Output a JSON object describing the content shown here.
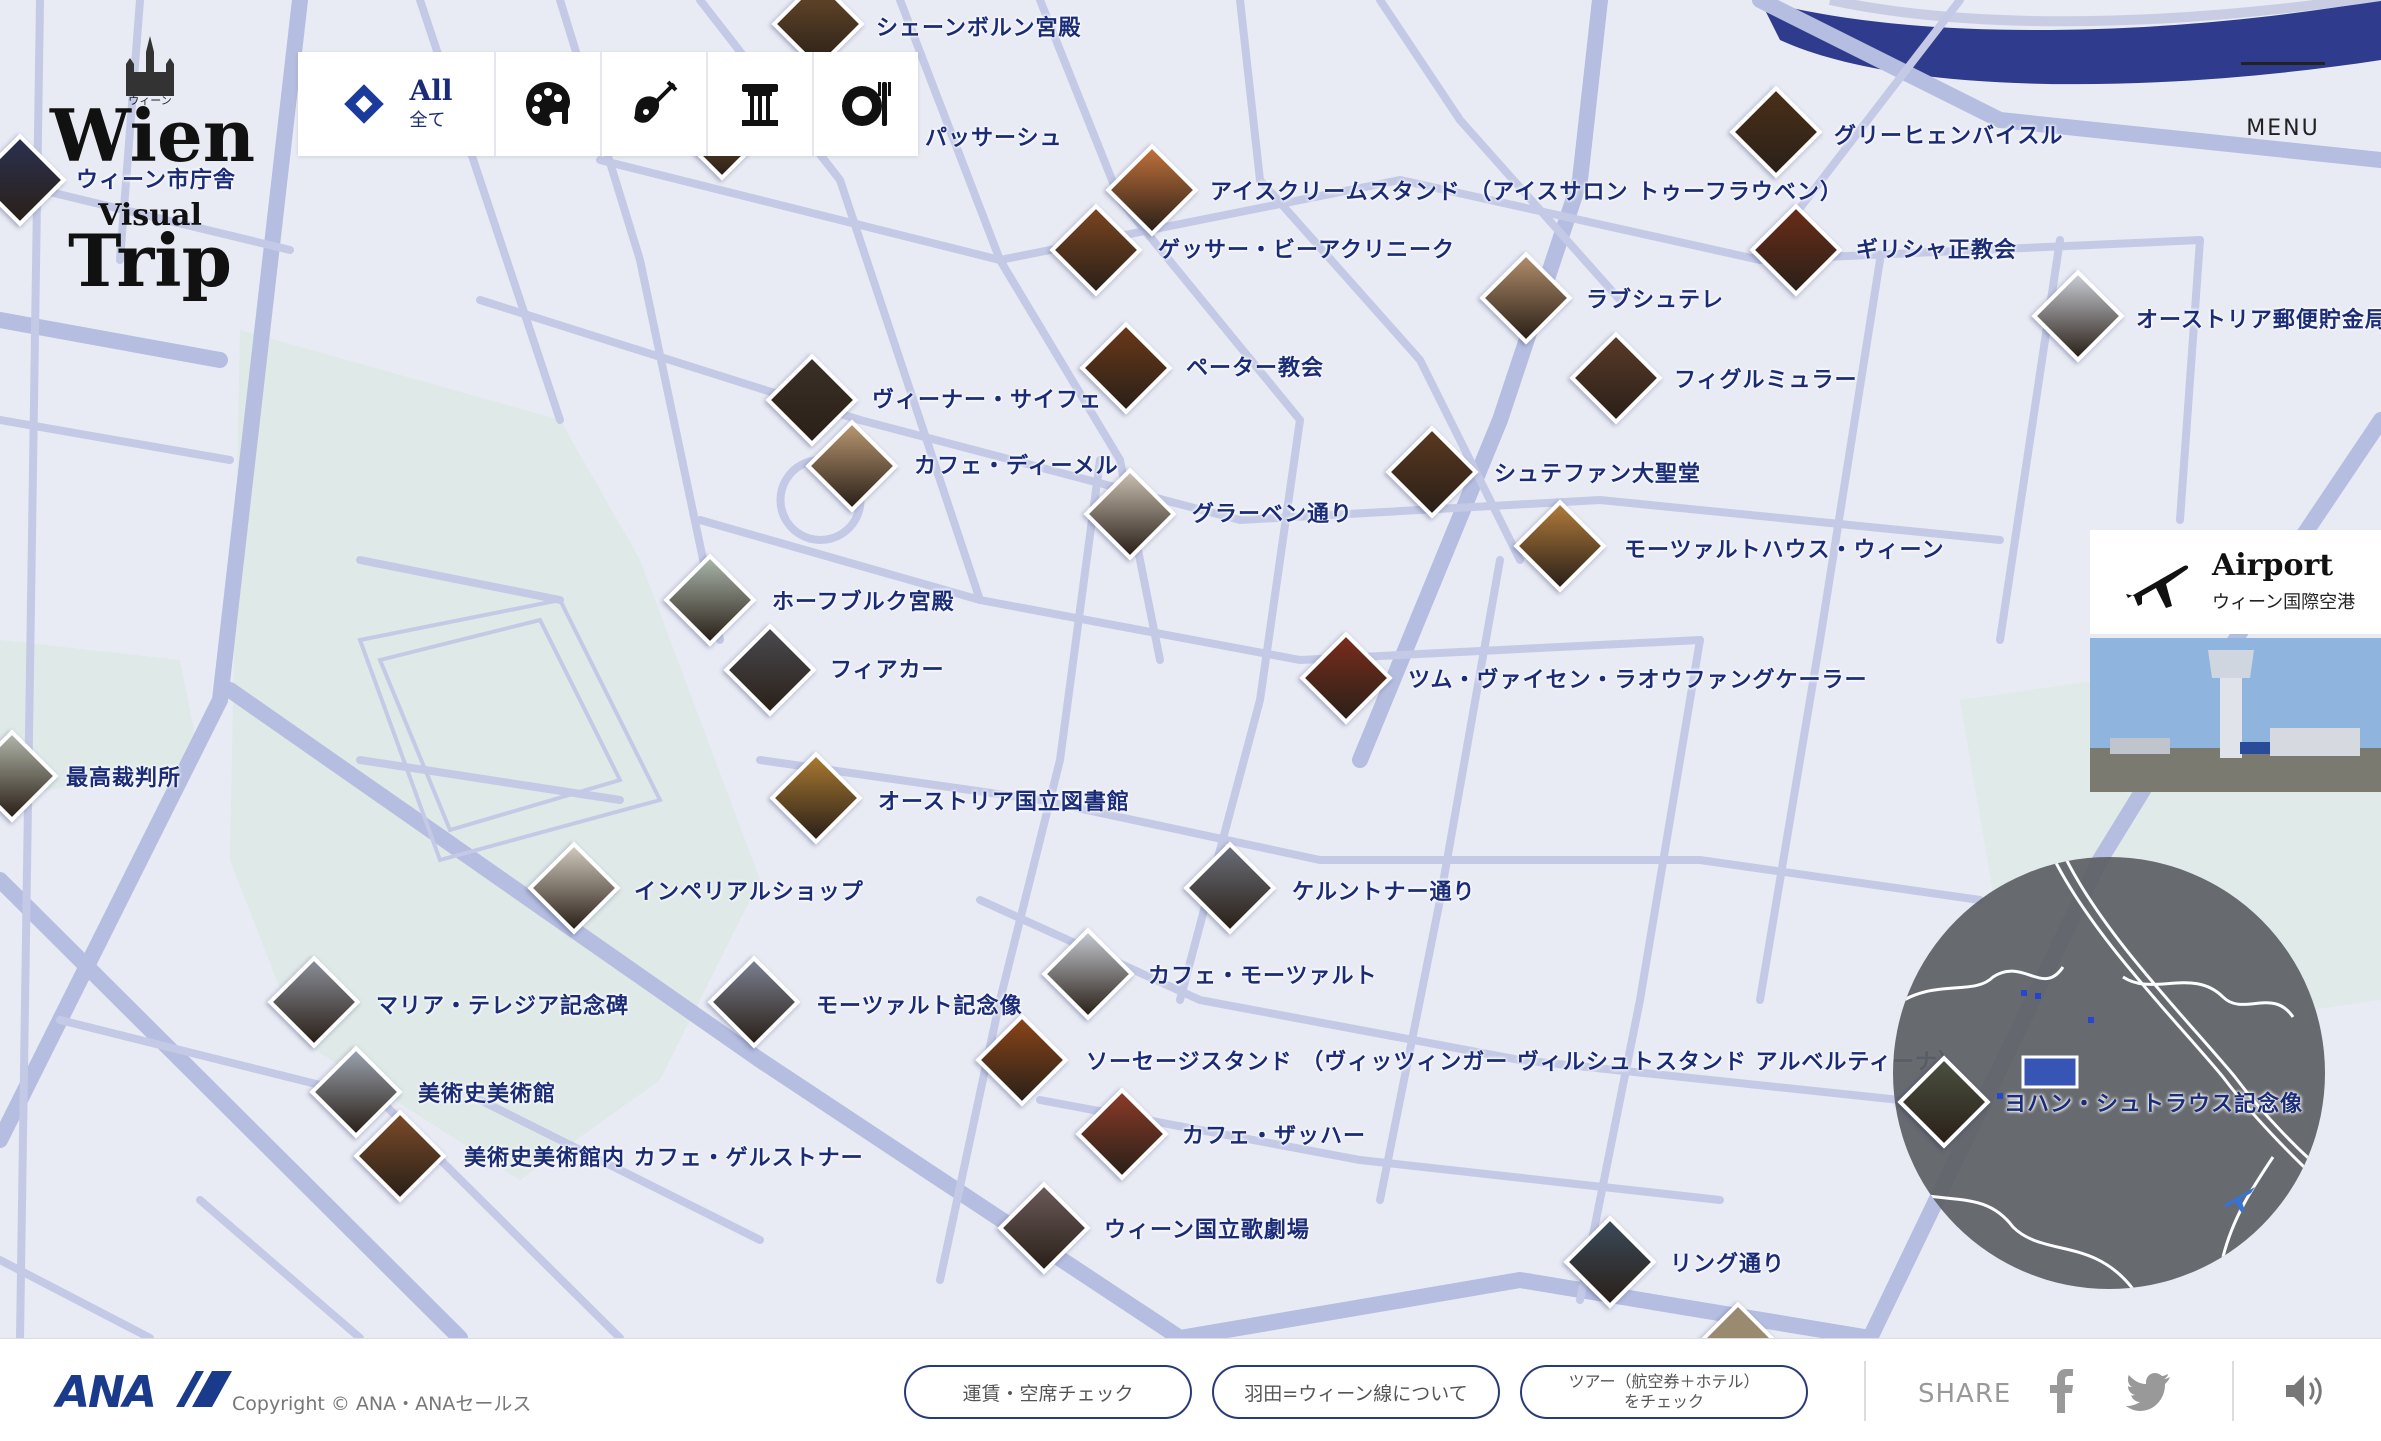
{
  "logo": {
    "ruby": "ウィーン",
    "line1": "Wien",
    "line2": "Visual",
    "line3": "Trip"
  },
  "filters": {
    "all_label": "All",
    "all_sub": "全て",
    "icons": [
      "palette-icon",
      "violin-icon",
      "column-icon",
      "dining-icon"
    ]
  },
  "menu": {
    "label": "MENU"
  },
  "airport": {
    "title": "Airport",
    "subtitle": "ウィーン国際空港",
    "icon": "airplane-icon"
  },
  "places": [
    {
      "label": "シェーンボルン宮殿",
      "color": "#6a4a2a"
    },
    {
      "label": "・パッサーシュ",
      "color": "#a06a3a"
    },
    {
      "label": "ウィーン市庁舎",
      "color": "#2a3050"
    },
    {
      "label": "アイスクリームスタンド （アイスサロン トゥーフラウベン）",
      "color": "#c0703a"
    },
    {
      "label": "ゲッサー・ビーアクリニーク",
      "color": "#7a4420"
    },
    {
      "label": "グリーヒェンバイスル",
      "color": "#4a3018"
    },
    {
      "label": "ギリシャ正教会",
      "color": "#6a2c18"
    },
    {
      "label": "ラブシュテレ",
      "color": "#b08c6a"
    },
    {
      "label": "オーストリア郵便貯金局",
      "color": "#c8ccd4"
    },
    {
      "label": "ペーター教会",
      "color": "#6a3818"
    },
    {
      "label": "フィグルミュラー",
      "color": "#5a3a28"
    },
    {
      "label": "ヴィーナー・サイフェ",
      "color": "#3a3028"
    },
    {
      "label": "カフェ・ディーメル",
      "color": "#b89670"
    },
    {
      "label": "シュテファン大聖堂",
      "color": "#5a3820"
    },
    {
      "label": "グラーベン通り",
      "color": "#c8beb0"
    },
    {
      "label": "モーツァルトハウス・ウィーン",
      "color": "#b07a3a"
    },
    {
      "label": "ホーフブルク宮殿",
      "color": "#a8b4a8"
    },
    {
      "label": "フィアカー",
      "color": "#4a4a50"
    },
    {
      "label": "ツム・ヴァイセン・ラオウファングケーラー",
      "color": "#7a2c1c"
    },
    {
      "label": "最高裁判所",
      "color": "#b0b4a8"
    },
    {
      "label": "オーストリア国立図書館",
      "color": "#a87830"
    },
    {
      "label": "インペリアルショップ",
      "color": "#d0c8bc"
    },
    {
      "label": "ケルントナー通り",
      "color": "#6a6e78"
    },
    {
      "label": "マリア・テレジア記念碑",
      "color": "#8a8e98"
    },
    {
      "label": "モーツァルト記念像",
      "color": "#7a8090"
    },
    {
      "label": "カフェ・モーツァルト",
      "color": "#c4c8d0"
    },
    {
      "label": "ソーセージスタンド （ヴィッツィンガー ヴィルシュトスタンド アルベルティーナ）",
      "color": "#8a4418"
    },
    {
      "label": "美術史美術館",
      "color": "#9aa2ae"
    },
    {
      "label": "美術史美術館内 カフェ・ゲルストナー",
      "color": "#7a4a28"
    },
    {
      "label": "カフェ・ザッハー",
      "color": "#8a3a28"
    },
    {
      "label": "ヨハン・シュトラウス記念像",
      "color": "#4a5040"
    },
    {
      "label": "ウィーン国立歌劇場",
      "color": "#6a5a5a"
    },
    {
      "label": "リング通り",
      "color": "#3a4a5a"
    }
  ],
  "footer": {
    "brand": "ANA",
    "copyright": "Copyright © ANA・ANAセールス",
    "buttons": [
      "運賃・空席チェック",
      "羽田=ウィーン線について",
      "ツアー（航空券＋ホテル）",
      "をチェック"
    ],
    "share_label": "SHARE",
    "social_icons": [
      "facebook-icon",
      "twitter-icon"
    ],
    "sound_icon": "speaker-icon"
  }
}
